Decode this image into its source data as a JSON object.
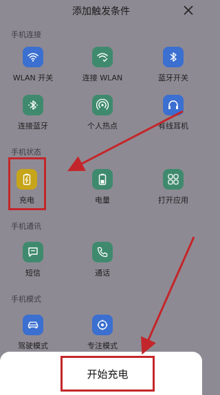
{
  "header": {
    "title": "添加触发条件",
    "close_icon": "close-icon"
  },
  "sections": [
    {
      "title": "手机连接",
      "items": [
        {
          "label": "WLAN 开关",
          "icon": "wifi-icon",
          "color": "#3b6fd0"
        },
        {
          "label": "连接 WLAN",
          "icon": "wifi-check-icon",
          "color": "#3f8a6e"
        },
        {
          "label": "蓝牙开关",
          "icon": "bluetooth-icon",
          "color": "#3b6fd0"
        },
        {
          "label": "连接蓝牙",
          "icon": "bluetooth-connect-icon",
          "color": "#3f8a6e"
        },
        {
          "label": "个人热点",
          "icon": "hotspot-icon",
          "color": "#3f8a6e"
        },
        {
          "label": "有线耳机",
          "icon": "headset-icon",
          "color": "#3b6fd0"
        }
      ]
    },
    {
      "title": "手机状态",
      "items": [
        {
          "label": "充电",
          "icon": "battery-charging-icon",
          "color": "#c7a51a"
        },
        {
          "label": "电量",
          "icon": "battery-icon",
          "color": "#3f8a6e"
        },
        {
          "label": "打开应用",
          "icon": "apps-icon",
          "color": "#3f8a6e"
        }
      ]
    },
    {
      "title": "手机通讯",
      "items": [
        {
          "label": "短信",
          "icon": "message-icon",
          "color": "#3f8a6e"
        },
        {
          "label": "通话",
          "icon": "phone-icon",
          "color": "#3f8a6e"
        }
      ]
    },
    {
      "title": "手机模式",
      "items": [
        {
          "label": "驾驶模式",
          "icon": "car-icon",
          "color": "#3b6fd0"
        },
        {
          "label": "专注模式",
          "icon": "focus-icon",
          "color": "#3b6fd0"
        }
      ]
    }
  ],
  "bottom": {
    "label": "开始充电"
  },
  "annotation_color": "#c3262a"
}
